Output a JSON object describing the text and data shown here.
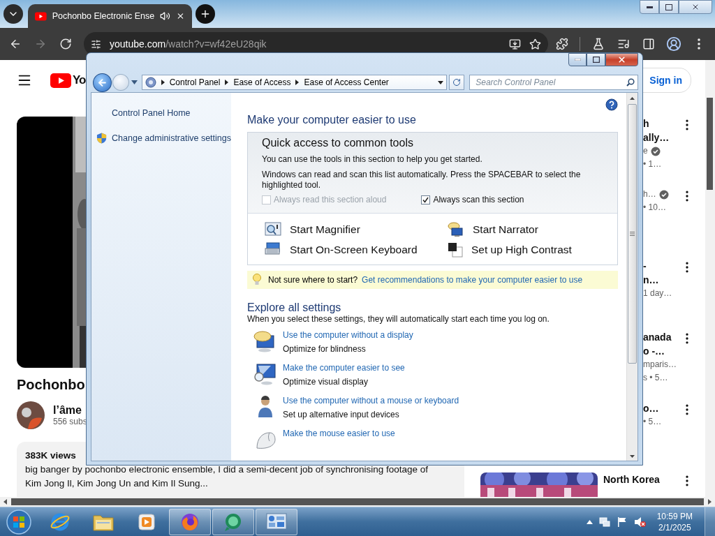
{
  "browser": {
    "tab": {
      "title": "Pochonbo Electronic Ense",
      "audible": true
    },
    "nav": [
      {
        "kind": "back",
        "disabled": false
      },
      {
        "kind": "forward",
        "disabled": true
      },
      {
        "kind": "reload",
        "disabled": false
      }
    ],
    "address": {
      "host": "youtube.com",
      "path": "/watch?v=wf42eU28qik"
    }
  },
  "youtube": {
    "logo_text": "Yo",
    "sign_in": "Sign in",
    "video_title": "Pochonbo",
    "channel": {
      "name": "l’âme",
      "subscribers": "556 subs"
    },
    "description": {
      "views": "383K views",
      "lines": [
        "big banger by pochonbo electronic ensemble, I did a semi-decent job of synchronising footage of",
        "Kim Jong Il, Kim Jong Un and Kim Il Sung..."
      ]
    },
    "recommendations": [
      {
        "kind": "clipped",
        "title_lines": [
          "h",
          "ally…"
        ],
        "channel": "e",
        "verified": true,
        "meta": "• 1…"
      },
      {
        "kind": "clipped",
        "channel": "h…",
        "verified": true,
        "meta": "• 10…"
      },
      {
        "kind": "clipped",
        "title_lines": [
          "-",
          "n…"
        ],
        "verified": false,
        "meta": "1 day…"
      },
      {
        "kind": "clipped",
        "title_lines": [
          "anada",
          "o -…"
        ],
        "channel": "mparis…",
        "verified": false,
        "meta": "s • 5…"
      },
      {
        "kind": "clipped",
        "title_lines": [
          "o…"
        ],
        "verified": false,
        "meta": "• 5…"
      },
      {
        "kind": "full",
        "title_lines": [
          "North Korea"
        ],
        "verified": false
      }
    ]
  },
  "control_panel": {
    "breadcrumb": [
      "Control Panel",
      "Ease of Access",
      "Ease of Access Center"
    ],
    "search_placeholder": "Search Control Panel",
    "tasks": [
      {
        "kind": "link",
        "label": "Control Panel Home"
      },
      {
        "kind": "admin",
        "label": "Change administrative settings"
      }
    ],
    "heading": "Make your computer easier to use",
    "quick": {
      "title": "Quick access to common tools",
      "lines": [
        "You can use the tools in this section to help you get started.",
        "Windows can read and scan this list automatically.  Press the SPACEBAR to select the highlighted tool."
      ],
      "checkboxes": [
        {
          "label": "Always read this section aloud",
          "checked": false,
          "disabled": true
        },
        {
          "label": "Always scan this section",
          "checked": true,
          "disabled": false
        }
      ],
      "tools": [
        {
          "kind": "magnifier",
          "label": "Start Magnifier"
        },
        {
          "kind": "narrator",
          "label": "Start Narrator"
        },
        {
          "kind": "keyboard",
          "label": "Start On-Screen Keyboard"
        },
        {
          "kind": "contrast",
          "label": "Set up High Contrast"
        }
      ]
    },
    "tip": {
      "text": "Not sure where to start?",
      "link": "Get recommendations to make your computer easier to use"
    },
    "explore": {
      "title": "Explore all settings",
      "subtitle": "When you select these settings, they will automatically start each time you log on.",
      "items": [
        {
          "kind": "no-display",
          "link": "Use the computer without a display",
          "description": "Optimize for blindness"
        },
        {
          "kind": "see",
          "link": "Make the computer easier to see",
          "description": "Optimize visual display"
        },
        {
          "kind": "no-mouse",
          "link": "Use the computer without a mouse or keyboard",
          "description": "Set up alternative input devices"
        },
        {
          "kind": "mouse",
          "link": "Make the mouse easier to use"
        }
      ]
    }
  },
  "taskbar": {
    "apps": [
      {
        "kind": "ie",
        "running": false
      },
      {
        "kind": "explorer",
        "running": false
      },
      {
        "kind": "media",
        "running": false
      },
      {
        "kind": "firefox",
        "running": true
      },
      {
        "kind": "chat",
        "running": true
      },
      {
        "kind": "control-panel",
        "running": true
      }
    ],
    "time": "10:59 PM",
    "date": "2/1/2025"
  }
}
